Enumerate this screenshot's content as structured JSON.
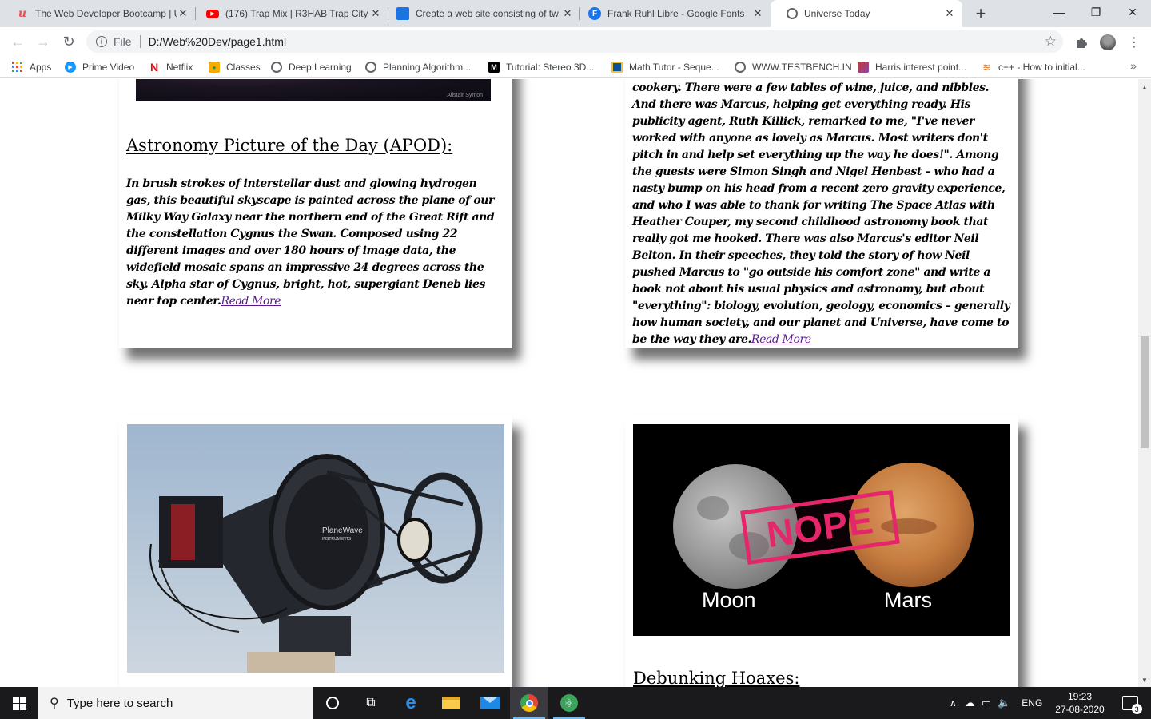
{
  "browser": {
    "tabs": [
      {
        "title": "The Web Developer Bootcamp | U",
        "icon": "udemy-icon",
        "color": "#ec5252"
      },
      {
        "title": "(176) Trap Mix | R3HAB Trap City",
        "icon": "youtube-icon",
        "color": "#ff0000"
      },
      {
        "title": "Create a web site consisting of tw",
        "icon": "classroom-icon",
        "color": "#1a73e8"
      },
      {
        "title": "Frank Ruhl Libre - Google Fonts",
        "icon": "google-fonts-icon",
        "color": "#1a73e8"
      },
      {
        "title": "Universe Today",
        "icon": "globe-icon",
        "color": "#5f6368",
        "active": true
      }
    ],
    "new_tab": "+",
    "address": {
      "scheme_label": "File",
      "url": "D:/Web%20Dev/page1.html"
    },
    "bookmarks": [
      {
        "label": "Apps",
        "icon": "apps-grid-icon"
      },
      {
        "label": "Prime Video",
        "icon": "prime-video-icon"
      },
      {
        "label": "Netflix",
        "icon": "netflix-icon"
      },
      {
        "label": "Classes",
        "icon": "classroom-icon"
      },
      {
        "label": "Deep Learning",
        "icon": "globe-icon"
      },
      {
        "label": "Planning Algorithm...",
        "icon": "globe-icon"
      },
      {
        "label": "Tutorial: Stereo 3D...",
        "icon": "medium-icon"
      },
      {
        "label": "Math Tutor - Seque...",
        "icon": "doc-icon"
      },
      {
        "label": "WWW.TESTBENCH.IN",
        "icon": "globe-icon"
      },
      {
        "label": "Harris interest point...",
        "icon": "image-icon"
      },
      {
        "label": "c++ - How to initial...",
        "icon": "stackoverflow-icon"
      }
    ],
    "bookmarks_more": "»"
  },
  "page": {
    "card_apod": {
      "title": "Astronomy Picture of the Day (APOD):",
      "text": "In brush strokes of interstellar dust and glowing hydrogen gas, this beautiful skyscape is painted across the plane of our Milky Way Galaxy near the northern end of the Great Rift and the constellation Cygnus the Swan. Composed using 22 different images and over 180 hours of image data, the widefield mosaic spans an impressive 24 degrees across the sky. Alpha star of Cygnus, bright, hot, supergiant Deneb lies near top center.",
      "link": "Read More",
      "image_credit": "Alistair Symon"
    },
    "card_book": {
      "text": "cookery. There were a few tables of wine, juice, and nibbles. And there was Marcus, helping get everything ready. His publicity agent, Ruth Killick, remarked to me, \"I've never worked with anyone as lovely as Marcus. Most writers don't pitch in and help set everything up the way he does!\". Among the guests were Simon Singh and Nigel Henbest – who had a nasty bump on his head from a recent zero gravity experience, and who I was able to thank for writing The Space Atlas with Heather Couper, my second childhood astronomy book that really got me hooked. There was also Marcus's editor Neil Belton. In their speeches, they told the story of how Neil pushed Marcus to \"go outside his comfort zone\" and write a book not about his usual physics and astronomy, but about \"everything\": biology, evolution, geology, economics – generally how human society, and our planet and Universe, have come to be the way they are.",
      "link": "Read More"
    },
    "card_telescope": {
      "image_brand": "PlaneWave",
      "image_brand_sub": "INSTRUMENTS"
    },
    "card_hoax": {
      "image_stamp": "NOPE",
      "image_left_label": "Moon",
      "image_right_label": "Mars",
      "title": "Debunking Hoaxes:"
    }
  },
  "taskbar": {
    "search_placeholder": "Type here to search",
    "language": "ENG",
    "time": "19:23",
    "date": "27-08-2020",
    "notification_count": "3"
  }
}
